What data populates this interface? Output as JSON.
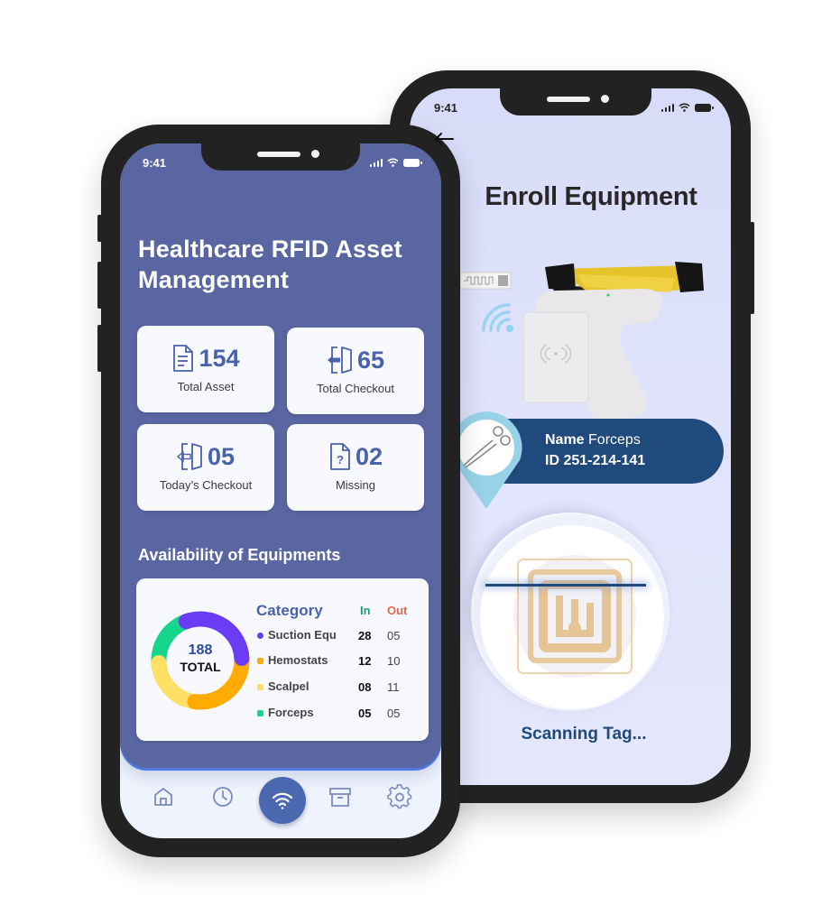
{
  "back_phone": {
    "status_time": "9:41",
    "title": "Enroll Equipment",
    "equipment": {
      "name_label": "Name",
      "name_value": "Forceps",
      "id_label": "ID",
      "id_value": "251-214-141"
    },
    "scan_status": "Scanning Tag...",
    "icons": [
      "back-arrow-icon",
      "rfid-label-icon",
      "wireless-signal-icon",
      "rfid-scanner-gun",
      "forceps-icon",
      "rfid-tag-icon"
    ]
  },
  "front_phone": {
    "status_time": "9:41",
    "title_line1": "Healthcare RFID Asset",
    "title_line2": "Management",
    "stats": [
      {
        "icon": "document-icon",
        "value": "154",
        "label": "Total Asset"
      },
      {
        "icon": "door-enter-icon",
        "value": "65",
        "label": "Total Checkout"
      },
      {
        "icon": "door-exit-icon",
        "value": "05",
        "label": "Today’s Checkout"
      },
      {
        "icon": "document-question-icon",
        "value": "02",
        "label": "Missing"
      }
    ],
    "availability": {
      "title": "Availability of Equipments",
      "total_value": "188",
      "total_label": "TOTAL",
      "headers": {
        "category": "Category",
        "in": "In",
        "out": "Out"
      },
      "rows": [
        {
          "name": "Suction Equ",
          "in": "28",
          "out": "05",
          "color": "#6a3cf6"
        },
        {
          "name": "Hemostats",
          "in": "12",
          "out": "10",
          "color": "#ffab00"
        },
        {
          "name": "Scalpel",
          "in": "08",
          "out": "11",
          "color": "#ffe066"
        },
        {
          "name": "Forceps",
          "in": "05",
          "out": "05",
          "color": "#16d68b"
        }
      ]
    },
    "tab_bar": [
      {
        "name": "home",
        "icon": "home-icon"
      },
      {
        "name": "history",
        "icon": "clock-icon"
      },
      {
        "name": "scan",
        "icon": "wifi-icon",
        "active": true
      },
      {
        "name": "inventory",
        "icon": "archive-box-icon"
      },
      {
        "name": "settings",
        "icon": "gear-icon"
      }
    ]
  },
  "chart_data": {
    "type": "pie",
    "title": "Availability of Equipments",
    "center_text": "188 TOTAL",
    "categories": [
      "Suction Equ",
      "Hemostats",
      "Scalpel",
      "Forceps"
    ],
    "series": [
      {
        "name": "In",
        "values": [
          28,
          12,
          8,
          5
        ]
      },
      {
        "name": "Out",
        "values": [
          5,
          10,
          11,
          5
        ]
      }
    ],
    "donut_segment_fractions": [
      0.28,
      0.28,
      0.22,
      0.22
    ],
    "colors": [
      "#6a3cf6",
      "#ffab00",
      "#ffe066",
      "#16d68b"
    ]
  },
  "colors": {
    "dashboard_bg": "#5a66a1",
    "accent_blue": "#4a62ab",
    "enroll_bg": "#d8dcf8",
    "pill_navy": "#204a7c",
    "in_green": "#1f9d6c",
    "out_orange": "#e2664b"
  }
}
